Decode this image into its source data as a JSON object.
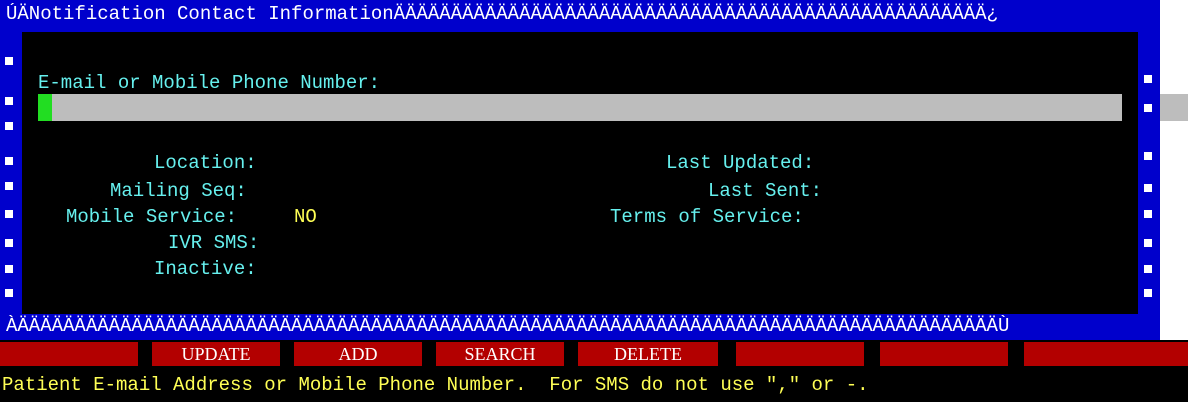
{
  "window": {
    "title": "ÚÄNotification Contact InformationÄÄÄÄÄÄÄÄÄÄÄÄÄÄÄÄÄÄÄÄÄÄÄÄÄÄÄÄÄÄÄÄÄÄÄÄÄÄÄÄÄÄÄÄÄÄÄÄÄÄÄÄ¿",
    "bottom_border": "ÀÄÄÄÄÄÄÄÄÄÄÄÄÄÄÄÄÄÄÄÄÄÄÄÄÄÄÄÄÄÄÄÄÄÄÄÄÄÄÄÄÄÄÄÄÄÄÄÄÄÄÄÄÄÄÄÄÄÄÄÄÄÄÄÄÄÄÄÄÄÄÄÄÄÄÄÄÄÄÄÄÄÄÄÄÄÄÙ"
  },
  "contact": {
    "label": "E-mail or Mobile Phone Number:",
    "value": ""
  },
  "fields_left": {
    "location_label": "Location:",
    "location_value": "",
    "mailing_seq_label": "Mailing Seq:",
    "mailing_seq_value": "",
    "mobile_service_label": "Mobile Service:",
    "mobile_service_value": "NO",
    "ivr_sms_label": "IVR SMS:",
    "ivr_sms_value": "",
    "inactive_label": "Inactive:",
    "inactive_value": ""
  },
  "fields_right": {
    "last_updated_label": "Last Updated:",
    "last_updated_value": "",
    "last_sent_label": "Last Sent:",
    "last_sent_value": "",
    "terms_label": "Terms of Service:",
    "terms_value": ""
  },
  "function_keys": {
    "f1": "",
    "f2": "UPDATE",
    "f3": "ADD",
    "f4": "SEARCH",
    "f5": "DELETE",
    "f6": "",
    "f7": "",
    "f8": ""
  },
  "status": {
    "message": "Patient E-mail Address or Mobile Phone Number.  For SMS do not use \",\" or -."
  },
  "colors": {
    "border_blue": "#0000cc",
    "label_cyan": "#66f0ee",
    "value_yellow": "#ffff55",
    "fkey_red": "#b30000",
    "cursor_green": "#22dd22",
    "input_gray": "#bdbdbd"
  }
}
